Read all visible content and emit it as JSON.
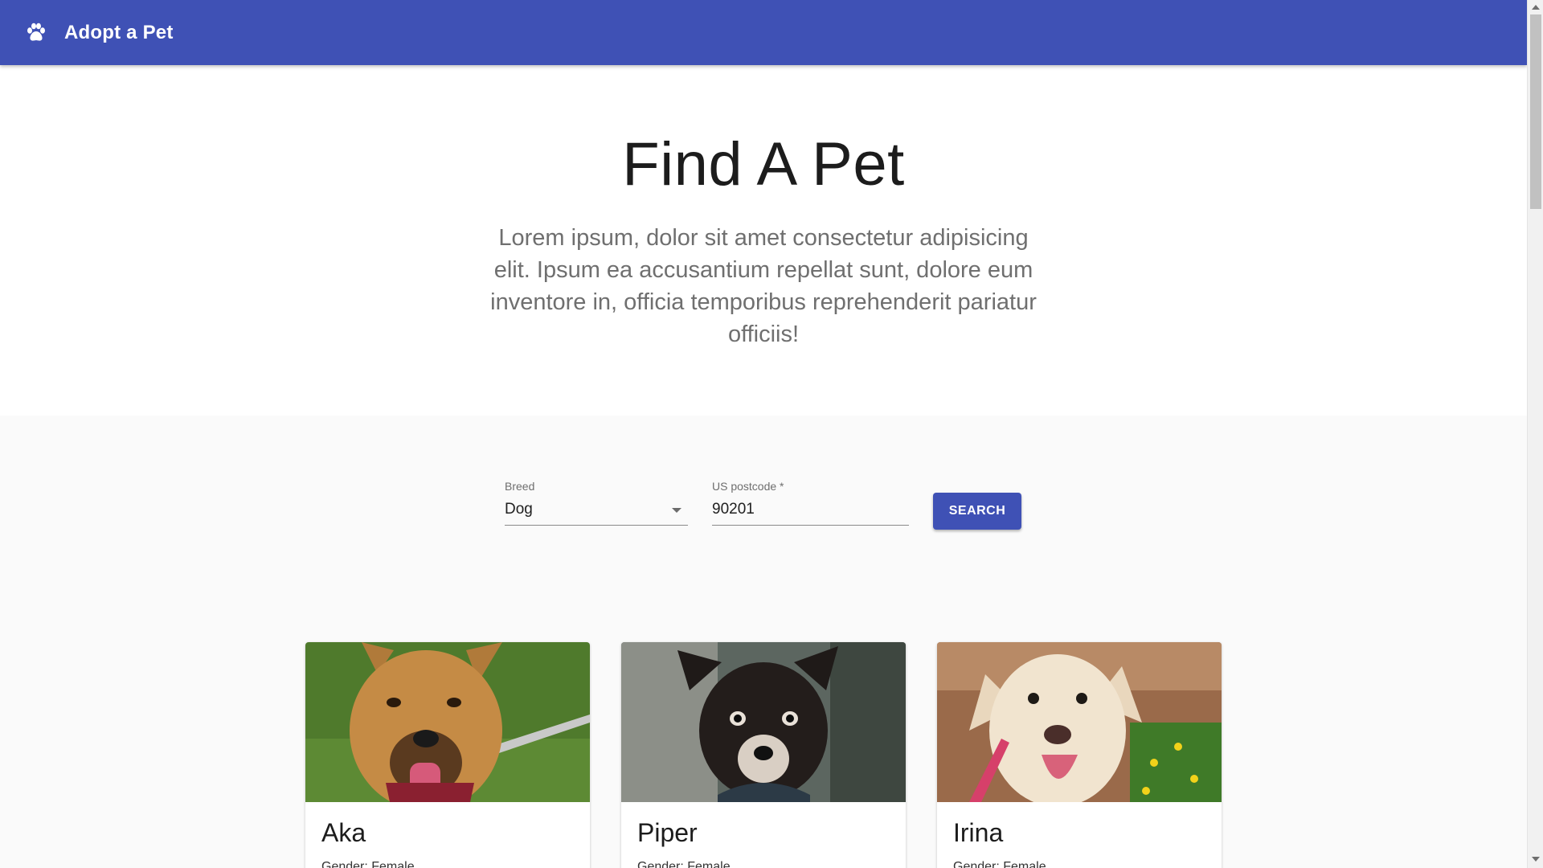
{
  "app": {
    "title": "Adopt a Pet",
    "icon": "paw-icon",
    "accent_color": "#3f51b5"
  },
  "hero": {
    "heading": "Find A Pet",
    "description": "Lorem ipsum, dolor sit amet consectetur adipisicing elit. Ipsum ea accusantium repellat sunt, dolore eum inventore in, officia temporibus reprehenderit pariatur officiis!"
  },
  "search": {
    "breed_label": "Breed",
    "breed_value": "Dog",
    "postcode_label": "US postcode *",
    "postcode_value": "90201",
    "button_label": "SEARCH"
  },
  "pets": [
    {
      "name": "Aka",
      "gender": "Gender: Female"
    },
    {
      "name": "Piper",
      "gender": "Gender: Female"
    },
    {
      "name": "Irina",
      "gender": "Gender: Female"
    }
  ]
}
